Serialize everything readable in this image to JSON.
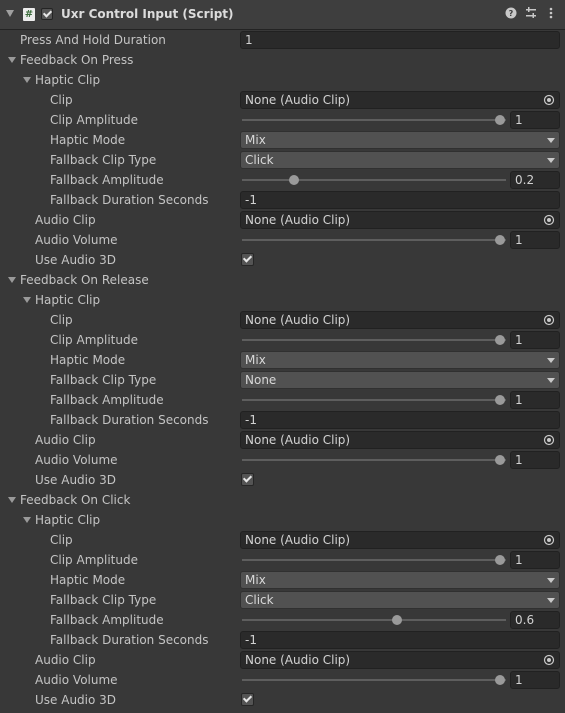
{
  "component": {
    "title": "Uxr Control Input (Script)",
    "script_icon": "script-icon",
    "enabled": true,
    "help_icon": "?",
    "settings_icon": "⧉",
    "menu_icon": "⋮"
  },
  "press_and_hold": {
    "label": "Press And Hold Duration",
    "value": "1"
  },
  "sections": [
    {
      "label": "Feedback On Press",
      "haptic_label": "Haptic Clip",
      "clip": {
        "label": "Clip",
        "value": "None (Audio Clip)"
      },
      "clip_amplitude": {
        "label": "Clip Amplitude",
        "value": "1",
        "fraction": 1.0
      },
      "haptic_mode": {
        "label": "Haptic Mode",
        "value": "Mix"
      },
      "fallback_clip_type": {
        "label": "Fallback Clip Type",
        "value": "Click"
      },
      "fallback_amplitude": {
        "label": "Fallback Amplitude",
        "value": "0.2",
        "fraction": 0.2
      },
      "fallback_duration": {
        "label": "Fallback Duration Seconds",
        "value": "-1"
      },
      "audio_clip": {
        "label": "Audio Clip",
        "value": "None (Audio Clip)"
      },
      "audio_volume": {
        "label": "Audio Volume",
        "value": "1",
        "fraction": 1.0
      },
      "use_audio_3d": {
        "label": "Use Audio 3D",
        "checked": true
      }
    },
    {
      "label": "Feedback On Release",
      "haptic_label": "Haptic Clip",
      "clip": {
        "label": "Clip",
        "value": "None (Audio Clip)"
      },
      "clip_amplitude": {
        "label": "Clip Amplitude",
        "value": "1",
        "fraction": 1.0
      },
      "haptic_mode": {
        "label": "Haptic Mode",
        "value": "Mix"
      },
      "fallback_clip_type": {
        "label": "Fallback Clip Type",
        "value": "None"
      },
      "fallback_amplitude": {
        "label": "Fallback Amplitude",
        "value": "1",
        "fraction": 1.0
      },
      "fallback_duration": {
        "label": "Fallback Duration Seconds",
        "value": "-1"
      },
      "audio_clip": {
        "label": "Audio Clip",
        "value": "None (Audio Clip)"
      },
      "audio_volume": {
        "label": "Audio Volume",
        "value": "1",
        "fraction": 1.0
      },
      "use_audio_3d": {
        "label": "Use Audio 3D",
        "checked": true
      }
    },
    {
      "label": "Feedback On Click",
      "haptic_label": "Haptic Clip",
      "clip": {
        "label": "Clip",
        "value": "None (Audio Clip)"
      },
      "clip_amplitude": {
        "label": "Clip Amplitude",
        "value": "1",
        "fraction": 1.0
      },
      "haptic_mode": {
        "label": "Haptic Mode",
        "value": "Mix"
      },
      "fallback_clip_type": {
        "label": "Fallback Clip Type",
        "value": "Click"
      },
      "fallback_amplitude": {
        "label": "Fallback Amplitude",
        "value": "0.6",
        "fraction": 0.6
      },
      "fallback_duration": {
        "label": "Fallback Duration Seconds",
        "value": "-1"
      },
      "audio_clip": {
        "label": "Audio Clip",
        "value": "None (Audio Clip)"
      },
      "audio_volume": {
        "label": "Audio Volume",
        "value": "1",
        "fraction": 1.0
      },
      "use_audio_3d": {
        "label": "Use Audio 3D",
        "checked": true
      }
    }
  ]
}
